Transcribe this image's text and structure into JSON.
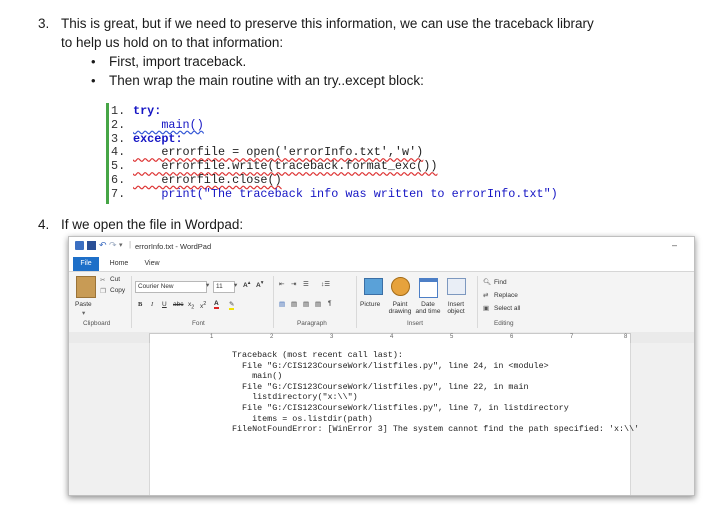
{
  "step3": {
    "number": "3.",
    "line1": "This is great, but if we need to preserve this information, we can use the traceback library",
    "line2": "to help us hold on to that information:",
    "bullets": [
      "First, import traceback.",
      "Then wrap the main routine with an try..except block:"
    ],
    "bullet_glyph": "•"
  },
  "code": {
    "lines": [
      {
        "n": "1.",
        "text": "try:"
      },
      {
        "n": "2.",
        "text": "    main()"
      },
      {
        "n": "3.",
        "text": "except:"
      },
      {
        "n": "4.",
        "text": "    errorfile = open('errorInfo.txt','w')"
      },
      {
        "n": "5.",
        "text": "    errorfile.write(traceback.format_exc())"
      },
      {
        "n": "6.",
        "text": "    errorfile.close()"
      },
      {
        "n": "7.",
        "text": "    print(\"The traceback info was written to errorInfo.txt\")"
      }
    ]
  },
  "step4": {
    "number": "4.",
    "text": "If we open the file in Wordpad:"
  },
  "wordpad": {
    "title": "errorInfo.txt - WordPad",
    "tabs": [
      "File",
      "Home",
      "View"
    ],
    "clipboard": {
      "paste": "Paste",
      "cut": "Cut",
      "copy": "Copy",
      "label": "Clipboard"
    },
    "font": {
      "name": "Courier New",
      "size": "11",
      "label": "Font"
    },
    "paragraph_label": "Paragraph",
    "insert": {
      "picture": "Picture",
      "paint": "Paint drawing",
      "datetime": "Date and time",
      "object": "Insert object",
      "label": "Insert"
    },
    "editing": {
      "find": "Find",
      "replace": "Replace",
      "select_all": "Select all",
      "label": "Editing"
    },
    "ruler_numbers": [
      "1",
      "2",
      "3",
      "4",
      "5",
      "6",
      "7",
      "8"
    ],
    "content": [
      "Traceback (most recent call last):",
      "  File \"G:/CIS123CourseWork/listfiles.py\", line 24, in <module>",
      "    main()",
      "  File \"G:/CIS123CourseWork/listfiles.py\", line 22, in main",
      "    listdirectory(\"x:\\\\\")",
      "  File \"G:/CIS123CourseWork/listfiles.py\", line 7, in listdirectory",
      "    items = os.listdir(path)",
      "FileNotFoundError: [WinError 3] The system cannot find the path specified: 'x:\\\\'"
    ]
  }
}
